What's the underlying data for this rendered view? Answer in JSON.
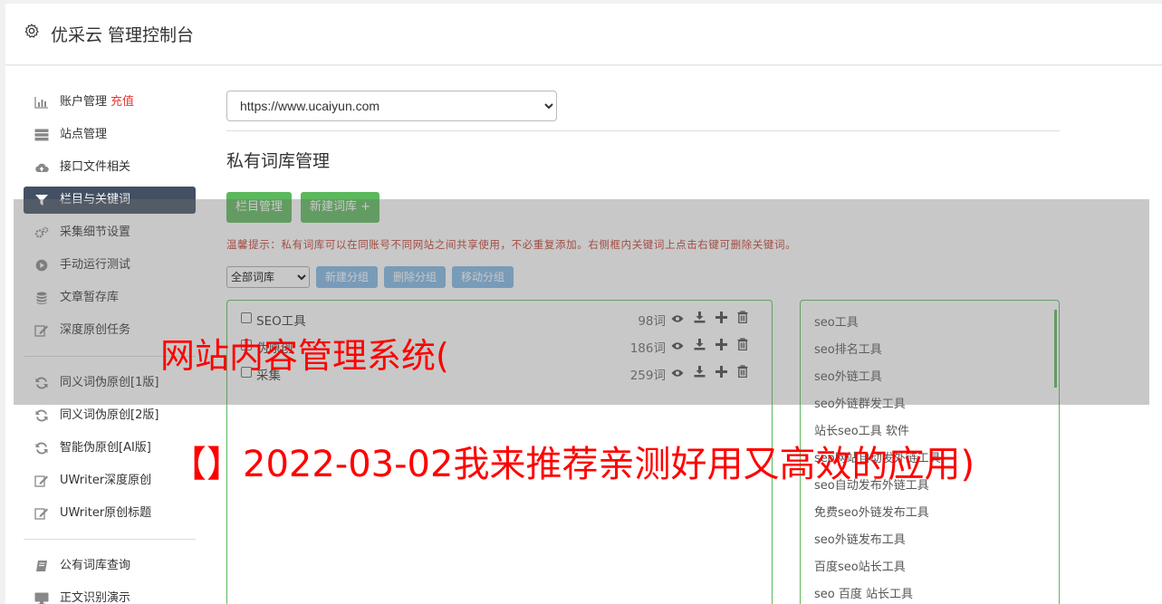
{
  "header": {
    "title": "优采云 管理控制台",
    "icon": "gear-icon"
  },
  "sidebar": {
    "items": [
      {
        "label": "账户管理",
        "icon": "bar-chart-icon",
        "badge": "充值"
      },
      {
        "label": "站点管理",
        "icon": "server-icon"
      },
      {
        "label": "接口文件相关",
        "icon": "cloud-upload-icon"
      },
      {
        "label": "栏目与关键词",
        "icon": "filter-icon",
        "active": true
      },
      {
        "label": "采集细节设置",
        "icon": "gears-icon"
      },
      {
        "label": "手动运行测试",
        "icon": "play-circle-icon"
      },
      {
        "label": "文章暂存库",
        "icon": "database-icon"
      },
      {
        "label": "深度原创任务",
        "icon": "edit-icon"
      }
    ],
    "items2": [
      {
        "label": "同义词伪原创[1版]",
        "icon": "refresh-icon"
      },
      {
        "label": "同义词伪原创[2版]",
        "icon": "refresh-icon"
      },
      {
        "label": "智能伪原创[AI版]",
        "icon": "refresh-icon"
      },
      {
        "label": "UWriter深度原创",
        "icon": "edit-icon"
      },
      {
        "label": "UWriter原创标题",
        "icon": "edit-icon"
      }
    ],
    "items3": [
      {
        "label": "公有词库查询",
        "icon": "book-icon"
      },
      {
        "label": "正文识别演示",
        "icon": "monitor-icon"
      }
    ]
  },
  "main": {
    "site_select": "https://www.ucaiyun.com",
    "section_title": "私有词库管理",
    "btn_column": "栏目管理",
    "btn_new_lib": "新建词库 +",
    "tip": "温馨提示：私有词库可以在同账号不同网站之间共享使用，不必重复添加。右侧框内关键词上点击右键可删除关键词。",
    "group_select": "全部词库",
    "btn_new_group": "新建分组",
    "btn_delete_group": "删除分组",
    "btn_move_group": "移动分组",
    "libraries": [
      {
        "name": "SEO工具",
        "count": "98词"
      },
      {
        "name": "伪原创",
        "count": "186词"
      },
      {
        "name": "采集",
        "count": "259词"
      }
    ],
    "keywords": [
      "seo工具",
      "seo排名工具",
      "seo外链工具",
      "seo外链群发工具",
      "站长seo工具 软件",
      "seo网站自动发外链工具",
      "seo自动发布外链工具",
      "免费seo外链发布工具",
      "seo外链发布工具",
      "百度seo站长工具",
      "seo 百度 站长工具"
    ]
  },
  "overlay": {
    "title": "网站内容管理系统(",
    "subtitle": "【】2022-03-02我来推荐亲测好用又高效的应用)"
  }
}
